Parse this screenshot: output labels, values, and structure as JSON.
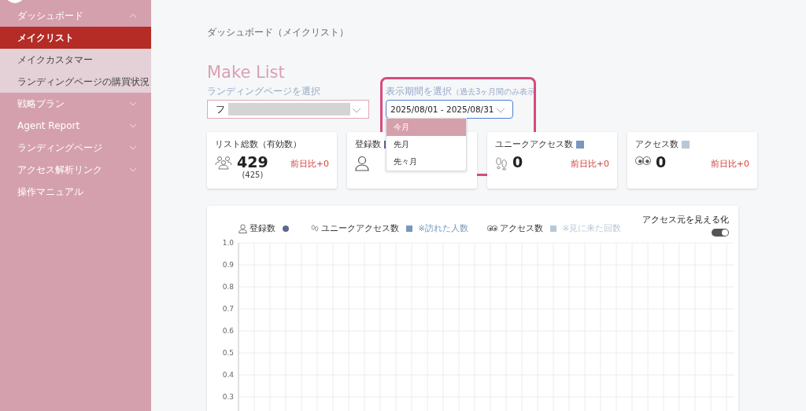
{
  "sidebar": {
    "items": [
      {
        "label": "ダッシュボード",
        "kind": "group",
        "expanded": true,
        "children": [
          {
            "label": "メイクリスト",
            "selected": true
          },
          {
            "label": "メイクカスタマー",
            "selected": false
          },
          {
            "label": "ランディングページの購買状況",
            "selected": false
          }
        ]
      },
      {
        "label": "戦略プラン",
        "kind": "group",
        "expanded": false
      },
      {
        "label": "Agent Report",
        "kind": "group",
        "expanded": false
      },
      {
        "label": "ランディングページ",
        "kind": "group",
        "expanded": false
      },
      {
        "label": "アクセス解析リンク",
        "kind": "group",
        "expanded": false
      },
      {
        "label": "操作マニュアル",
        "kind": "link"
      }
    ]
  },
  "breadcrumb": "ダッシュボード（メイクリスト）",
  "title": "Make List",
  "lp_select": {
    "label": "ランディングページを選択",
    "value": "フ"
  },
  "period_select": {
    "label": "表示期間を選択",
    "note": "（過去3ヶ月間のみ表示",
    "value": "2025/08/01 - 2025/08/31",
    "options": [
      {
        "label": "今月",
        "selected": true
      },
      {
        "label": "先月",
        "selected": false
      },
      {
        "label": "先々月",
        "selected": false
      }
    ]
  },
  "stats": [
    {
      "label": "リスト総数（有効数）",
      "kind": "people",
      "value": "429",
      "sub": "(425)",
      "change": "前日比+0"
    },
    {
      "label": "登録数",
      "kind": "person",
      "color": "#5a6a8e"
    },
    {
      "label": "ユニークアクセス数",
      "kind": "footprints",
      "color": "#7898bd",
      "value": "0",
      "change": "前日比+0"
    },
    {
      "label": "アクセス数",
      "kind": "eyes",
      "color": "#b7c8d8",
      "value": "0",
      "change": "前日比+0"
    }
  ],
  "chart": {
    "legend": [
      {
        "label": "登録数",
        "kind": "person",
        "color": "#5a6a8e"
      },
      {
        "label": "ユニークアクセス数",
        "kind": "footprints",
        "color": "#7898bd",
        "note": "※訪れた人数"
      },
      {
        "label": "アクセス数",
        "kind": "eyes",
        "color": "#b7c8d8",
        "note": "※見に来た回数"
      }
    ],
    "toggle": {
      "label": "アクセス元を見える化",
      "on": true
    },
    "chart_data": {
      "type": "line",
      "grid": true,
      "ylim": [
        0.3,
        1.0
      ],
      "categories": [
        null,
        null,
        null,
        null,
        null,
        null,
        null,
        null,
        null,
        null,
        null,
        null,
        null,
        null,
        null,
        null,
        null,
        null,
        null,
        null,
        null,
        null,
        null,
        null,
        null,
        null,
        null,
        null,
        null,
        null,
        null,
        null
      ],
      "yticks": [
        {
          "value": 0.3,
          "label": "0.3"
        },
        {
          "value": 0.4,
          "label": "0.4"
        },
        {
          "value": 0.5,
          "label": "0.5"
        },
        {
          "value": 0.6,
          "label": "0.6"
        },
        {
          "value": 0.7,
          "label": "0.7"
        },
        {
          "value": 0.8,
          "label": "0.8"
        },
        {
          "value": 0.9,
          "label": "0.9"
        },
        {
          "value": 1.0,
          "label": "1.0"
        }
      ]
    }
  }
}
